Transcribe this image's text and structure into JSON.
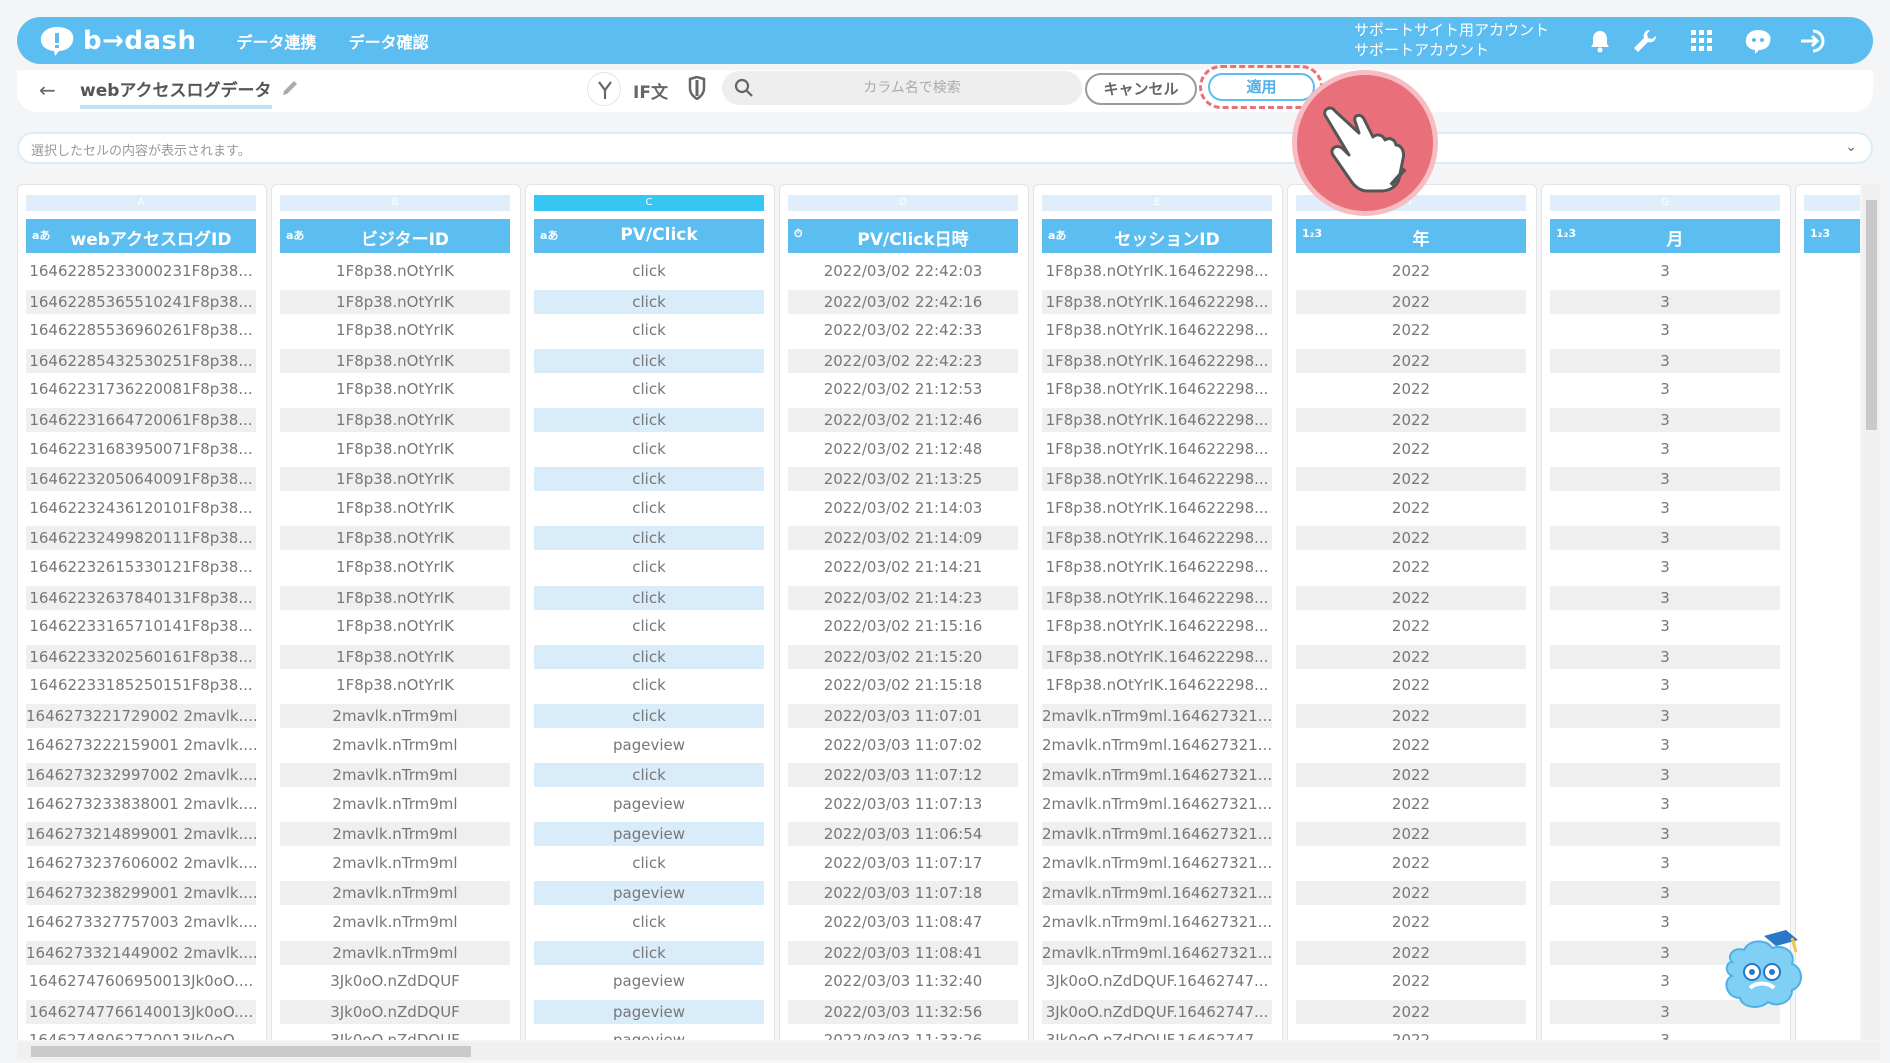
{
  "app": {
    "logo_text": "b→dash",
    "nav": [
      "データ連携",
      "データ確認"
    ],
    "account_line1": "サポートサイト用アカウント",
    "account_line2": "サポートアカウント"
  },
  "toolbar": {
    "back_arrow": "←",
    "title": "webアクセスログデータ",
    "if_label": "IF文",
    "search_placeholder": "カラム名で検索",
    "cancel_label": "キャンセル",
    "apply_label": "適用"
  },
  "cellbar": {
    "placeholder": "選択したセルの内容が表示されます。",
    "chevron": "⌄"
  },
  "colors": {
    "accent": "#5bbdf0",
    "highlight": "#e9707a"
  },
  "columns": [
    {
      "letter": "A",
      "type": "aあ",
      "title": "webアクセスログID",
      "values": [
        "16462285233000231F8p38...",
        "16462285365510241F8p38...",
        "16462285536960261F8p38...",
        "16462285432530251F8p38...",
        "16462231736220081F8p38...",
        "16462231664720061F8p38...",
        "16462231683950071F8p38...",
        "16462232050640091F8p38...",
        "16462232436120101F8p38...",
        "16462232499820111F8p38...",
        "16462232615330121F8p38...",
        "16462232637840131F8p38...",
        "16462233165710141F8p38...",
        "16462233202560161F8p38...",
        "16462233185250151F8p38...",
        "1646273221729002 2mavlk....",
        "1646273222159001 2mavlk....",
        "1646273232997002 2mavlk....",
        "1646273233838001 2mavlk....",
        "1646273214899001 2mavlk....",
        "1646273237606002 2mavlk....",
        "1646273238299001 2mavlk....",
        "1646273327757003 2mavlk....",
        "1646273321449002 2mavlk....",
        "16462747606950013Jk0oO....",
        "16462747766140013Jk0oO....",
        "16462748062720013Jk0oO...."
      ]
    },
    {
      "letter": "B",
      "type": "aあ",
      "title": "ビジターID",
      "values": [
        "1F8p38.nOtYrIK",
        "1F8p38.nOtYrIK",
        "1F8p38.nOtYrIK",
        "1F8p38.nOtYrIK",
        "1F8p38.nOtYrIK",
        "1F8p38.nOtYrIK",
        "1F8p38.nOtYrIK",
        "1F8p38.nOtYrIK",
        "1F8p38.nOtYrIK",
        "1F8p38.nOtYrIK",
        "1F8p38.nOtYrIK",
        "1F8p38.nOtYrIK",
        "1F8p38.nOtYrIK",
        "1F8p38.nOtYrIK",
        "1F8p38.nOtYrIK",
        "2mavlk.nTrm9ml",
        "2mavlk.nTrm9ml",
        "2mavlk.nTrm9ml",
        "2mavlk.nTrm9ml",
        "2mavlk.nTrm9ml",
        "2mavlk.nTrm9ml",
        "2mavlk.nTrm9ml",
        "2mavlk.nTrm9ml",
        "2mavlk.nTrm9ml",
        "3Jk0oO.nZdDQUF",
        "3Jk0oO.nZdDQUF",
        "3Jk0oO.nZdDQUF"
      ]
    },
    {
      "letter": "C",
      "type": "aあ",
      "title": "PV/Click",
      "values": [
        "click",
        "click",
        "click",
        "click",
        "click",
        "click",
        "click",
        "click",
        "click",
        "click",
        "click",
        "click",
        "click",
        "click",
        "click",
        "click",
        "pageview",
        "click",
        "pageview",
        "pageview",
        "click",
        "pageview",
        "click",
        "click",
        "pageview",
        "pageview",
        "pageview"
      ]
    },
    {
      "letter": "D",
      "type": "⏱",
      "title": "PV/Click日時",
      "values": [
        "2022/03/02 22:42:03",
        "2022/03/02 22:42:16",
        "2022/03/02 22:42:33",
        "2022/03/02 22:42:23",
        "2022/03/02 21:12:53",
        "2022/03/02 21:12:46",
        "2022/03/02 21:12:48",
        "2022/03/02 21:13:25",
        "2022/03/02 21:14:03",
        "2022/03/02 21:14:09",
        "2022/03/02 21:14:21",
        "2022/03/02 21:14:23",
        "2022/03/02 21:15:16",
        "2022/03/02 21:15:20",
        "2022/03/02 21:15:18",
        "2022/03/03 11:07:01",
        "2022/03/03 11:07:02",
        "2022/03/03 11:07:12",
        "2022/03/03 11:07:13",
        "2022/03/03 11:06:54",
        "2022/03/03 11:07:17",
        "2022/03/03 11:07:18",
        "2022/03/03 11:08:47",
        "2022/03/03 11:08:41",
        "2022/03/03 11:32:40",
        "2022/03/03 11:32:56",
        "2022/03/03 11:33:26"
      ]
    },
    {
      "letter": "E",
      "type": "aあ",
      "title": "セッションID",
      "values": [
        "1F8p38.nOtYrIK.164622298...",
        "1F8p38.nOtYrIK.164622298...",
        "1F8p38.nOtYrIK.164622298...",
        "1F8p38.nOtYrIK.164622298...",
        "1F8p38.nOtYrIK.164622298...",
        "1F8p38.nOtYrIK.164622298...",
        "1F8p38.nOtYrIK.164622298...",
        "1F8p38.nOtYrIK.164622298...",
        "1F8p38.nOtYrIK.164622298...",
        "1F8p38.nOtYrIK.164622298...",
        "1F8p38.nOtYrIK.164622298...",
        "1F8p38.nOtYrIK.164622298...",
        "1F8p38.nOtYrIK.164622298...",
        "1F8p38.nOtYrIK.164622298...",
        "1F8p38.nOtYrIK.164622298...",
        "2mavlk.nTrm9ml.164627321...",
        "2mavlk.nTrm9ml.164627321...",
        "2mavlk.nTrm9ml.164627321...",
        "2mavlk.nTrm9ml.164627321...",
        "2mavlk.nTrm9ml.164627321...",
        "2mavlk.nTrm9ml.164627321...",
        "2mavlk.nTrm9ml.164627321...",
        "2mavlk.nTrm9ml.164627321...",
        "2mavlk.nTrm9ml.164627321...",
        "3Jk0oO.nZdDQUF.16462747...",
        "3Jk0oO.nZdDQUF.16462747...",
        "3Jk0oO.nZdDQUF.16462747..."
      ]
    },
    {
      "letter": "F",
      "type": "1₂3",
      "title": "年",
      "values": [
        "2022",
        "2022",
        "2022",
        "2022",
        "2022",
        "2022",
        "2022",
        "2022",
        "2022",
        "2022",
        "2022",
        "2022",
        "2022",
        "2022",
        "2022",
        "2022",
        "2022",
        "2022",
        "2022",
        "2022",
        "2022",
        "2022",
        "2022",
        "2022",
        "2022",
        "2022",
        "2022"
      ]
    },
    {
      "letter": "G",
      "type": "1₂3",
      "title": "月",
      "values": [
        "3",
        "3",
        "3",
        "3",
        "3",
        "3",
        "3",
        "3",
        "3",
        "3",
        "3",
        "3",
        "3",
        "3",
        "3",
        "3",
        "3",
        "3",
        "3",
        "3",
        "3",
        "3",
        "3",
        "3",
        "3",
        "3",
        "3"
      ]
    },
    {
      "letter": "",
      "type": "1₂3",
      "title": "",
      "values": []
    }
  ]
}
